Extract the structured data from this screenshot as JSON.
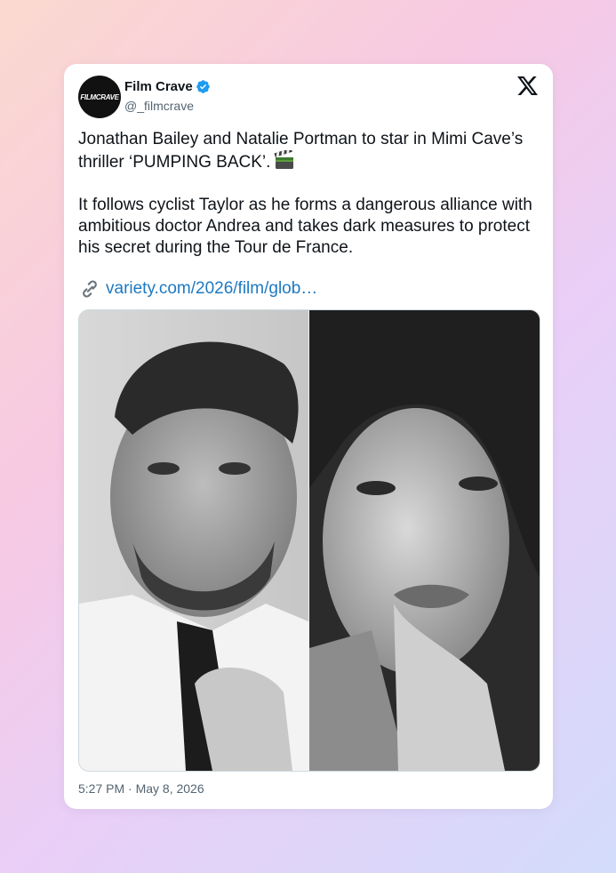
{
  "post": {
    "author_logo_text": "FILMCRAVE",
    "author_name": "Film Crave",
    "handle": "@_filmcrave",
    "paragraph1": "Jonathan Bailey and Natalie Portman to star in Mimi Cave’s thriller ‘PUMPING BACK’.",
    "paragraph2": "It follows cyclist Taylor as he forms a dangerous alliance with ambitious doctor Andrea and takes dark measures to protect his secret during the Tour de France.",
    "link_text": "variety.com/2026/film/glob…",
    "timestamp": "5:27 PM · May 8, 2026"
  },
  "icons": {
    "verified": "verified-badge-icon",
    "platform": "x-logo-icon",
    "emoji": "clapper-board-icon",
    "link": "link-icon"
  },
  "colors": {
    "verified_blue": "#1d9bf0",
    "link_blue": "#1d79c2",
    "text": "#0f1419",
    "muted": "#536471"
  }
}
